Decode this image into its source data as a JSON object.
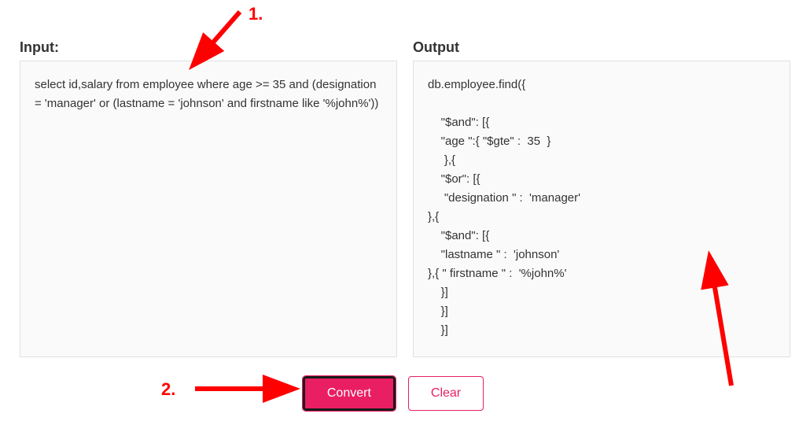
{
  "labels": {
    "input": "Input:",
    "output": "Output"
  },
  "input_text": "select id,salary from employee where age >= 35 and (designation = 'manager' or (lastname = 'johnson' and firstname like '%john%'))",
  "output_text": "db.employee.find({\n\n    \"$and\": [{\n    \"age \":{ \"$gte\" :  35  }\n     },{\n    \"$or\": [{\n     \"designation \" :  'manager'\n},{\n    \"$and\": [{\n    \"lastname \" :  'johnson'\n},{ \" firstname \" :  '%john%'\n    }]\n    }]\n    }]",
  "buttons": {
    "convert": "Convert",
    "clear": "Clear"
  },
  "annotations": {
    "one": "1.",
    "two": "2."
  }
}
